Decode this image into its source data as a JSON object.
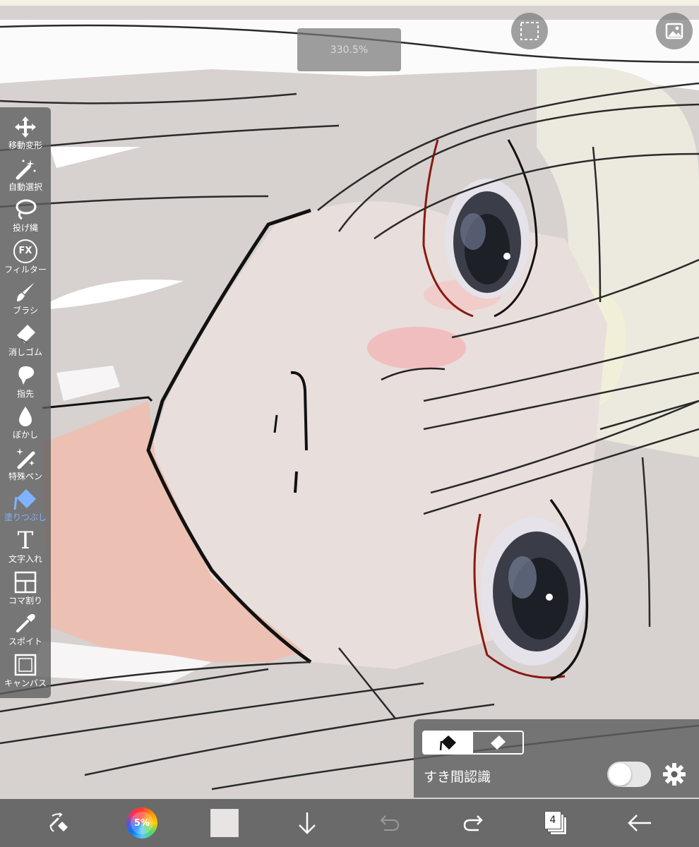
{
  "zoom": {
    "level": "330.5%"
  },
  "top_right": {
    "selection_icon": "dashed-square-icon",
    "reference_icon": "image-icon"
  },
  "tools": [
    {
      "label": "移動変形",
      "icon": "move-arrows-icon"
    },
    {
      "label": "自動選択",
      "icon": "magic-wand-icon"
    },
    {
      "label": "投げ縄",
      "icon": "lasso-icon"
    },
    {
      "label": "フィルター",
      "icon": "fx-icon",
      "icon_text": "FX"
    },
    {
      "label": "ブラシ",
      "icon": "brush-icon"
    },
    {
      "label": "消しゴム",
      "icon": "eraser-icon"
    },
    {
      "label": "指先",
      "icon": "smudge-finger-icon"
    },
    {
      "label": "ぼかし",
      "icon": "blur-drop-icon"
    },
    {
      "label": "特殊ペン",
      "icon": "special-pen-icon"
    },
    {
      "label": "塗りつぶし",
      "icon": "fill-bucket-icon",
      "active": true
    },
    {
      "label": "文字入れ",
      "icon": "text-icon",
      "icon_text": "T"
    },
    {
      "label": "コマ割り",
      "icon": "frame-divider-icon"
    },
    {
      "label": "スポイト",
      "icon": "eyedropper-icon"
    },
    {
      "label": "キャンバス",
      "icon": "canvas-icon"
    }
  ],
  "fill_panel": {
    "mode_fill_icon": "fill-icon",
    "mode_erase_icon": "eraser-icon",
    "selected_mode": "fill",
    "gap_detection_label": "すき間認識",
    "gap_detection_on": false,
    "settings_icon": "gear-icon"
  },
  "bottom_bar": {
    "transform_icon": "pen-eraser-swap-icon",
    "color_wheel_text": "5%",
    "current_color": "#e9e4e4",
    "download_icon": "arrow-down-icon",
    "undo_icon": "undo-icon",
    "redo_icon": "redo-icon",
    "layer_count": "4",
    "back_icon": "arrow-left-icon"
  },
  "colors": {
    "accent": "#7fb3ff",
    "panel_bg": "#5f5f5f",
    "skin": "#e8dfdc",
    "hair": "#c9c4c3",
    "eye_red": "#8a1a10"
  }
}
